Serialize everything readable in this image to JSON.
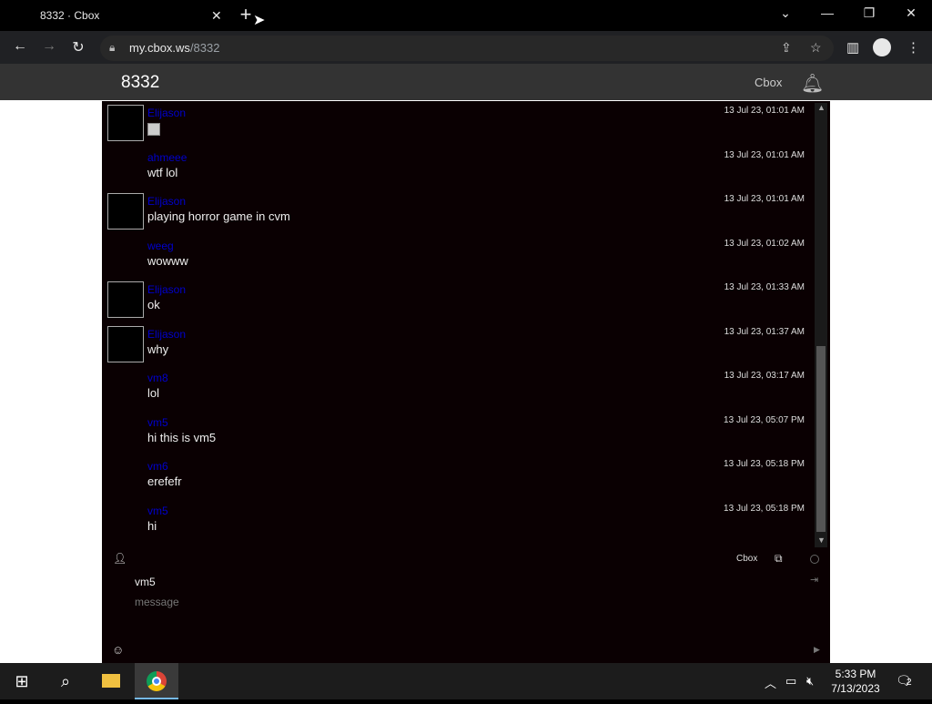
{
  "browser": {
    "tab_title": "8332 · Cbox",
    "tab_close": "✕",
    "new_tab": "+",
    "url_host": "my.cbox.ws",
    "url_path": "/8332"
  },
  "header": {
    "board_title": "8332",
    "brand": "Cbox"
  },
  "messages": [
    {
      "name": "Elijason",
      "text": "",
      "time": "13 Jul 23, 01:01 AM",
      "avatar": true,
      "image": true
    },
    {
      "name": "ahmeee",
      "text": "wtf lol",
      "time": "13 Jul 23, 01:01 AM",
      "avatar": false,
      "image": false
    },
    {
      "name": "Elijason",
      "text": "playing horror game in cvm",
      "time": "13 Jul 23, 01:01 AM",
      "avatar": true,
      "image": false
    },
    {
      "name": "weeg",
      "text": "wowww",
      "time": "13 Jul 23, 01:02 AM",
      "avatar": false,
      "image": false
    },
    {
      "name": "Elijason",
      "text": "ok",
      "time": "13 Jul 23, 01:33 AM",
      "avatar": true,
      "image": false
    },
    {
      "name": "Elijason",
      "text": "why",
      "time": "13 Jul 23, 01:37 AM",
      "avatar": true,
      "image": false
    },
    {
      "name": "vm8",
      "text": "lol",
      "time": "13 Jul 23, 03:17 AM",
      "avatar": false,
      "image": false
    },
    {
      "name": "vm5",
      "text": "hi this is vm5",
      "time": "13 Jul 23, 05:07 PM",
      "avatar": false,
      "image": false
    },
    {
      "name": "vm6",
      "text": "erefefr",
      "time": "13 Jul 23, 05:18 PM",
      "avatar": false,
      "image": false
    },
    {
      "name": "vm5",
      "text": "hi",
      "time": "13 Jul 23, 05:18 PM",
      "avatar": false,
      "image": false
    }
  ],
  "form": {
    "brand": "Cbox",
    "name_value": "vm5",
    "message_placeholder": "message"
  },
  "taskbar": {
    "time": "5:33 PM",
    "date": "7/13/2023",
    "notification_count": "2"
  }
}
